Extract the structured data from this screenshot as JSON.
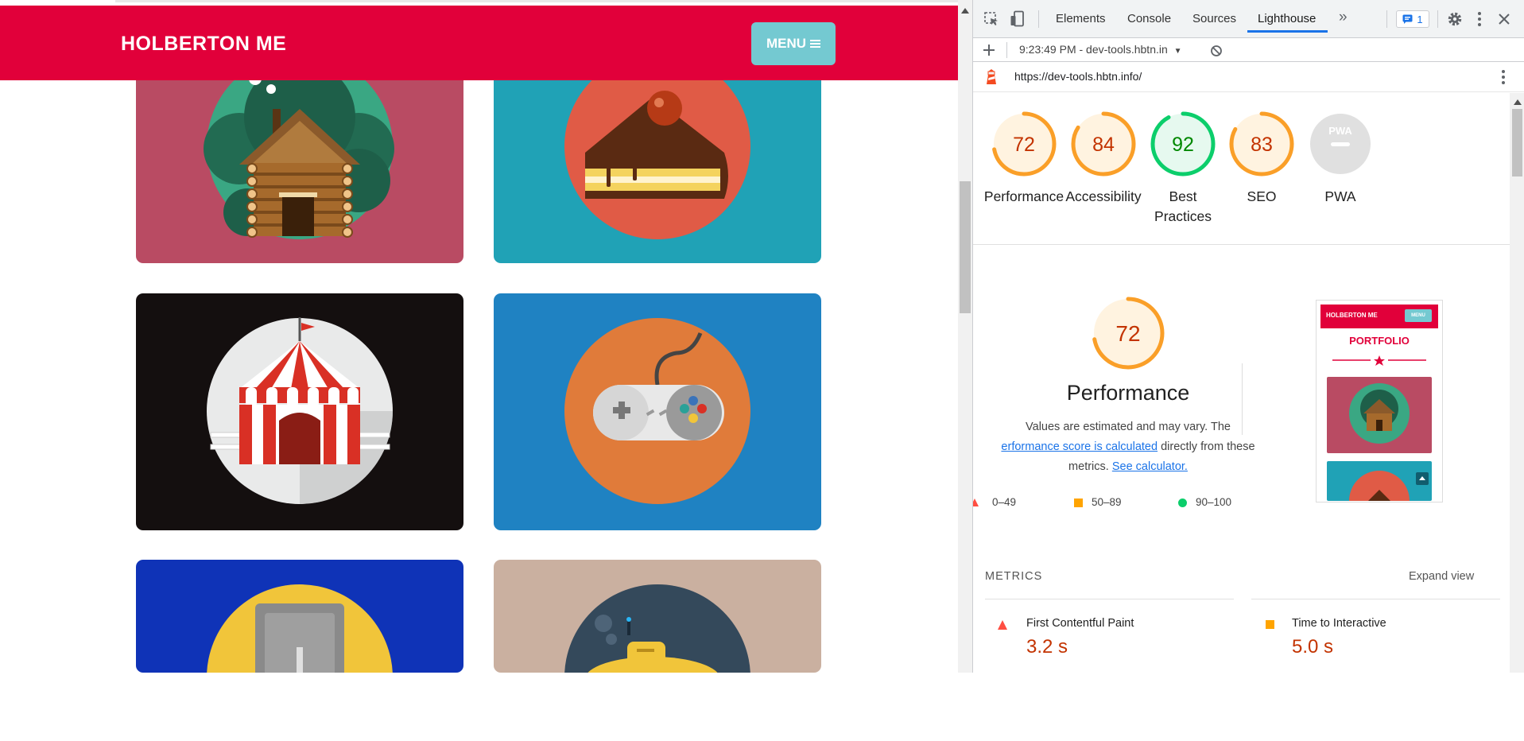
{
  "page": {
    "brand": "HOLBERTON ME",
    "menu_label": "MENU",
    "cards": [
      {
        "name": "cabin-illustration",
        "bg": "#b94b63",
        "circle": "#3aa783"
      },
      {
        "name": "cake-illustration",
        "bg": "#20a2b6",
        "circle": "#e05b46"
      },
      {
        "name": "circus-tent-illustration",
        "bg": "#140f0f",
        "circle": "#e9eaea"
      },
      {
        "name": "game-controller-illustration",
        "bg": "#1f82c2",
        "circle": "#e07b3a"
      },
      {
        "name": "safe-illustration",
        "bg": "#0f33b7",
        "circle": "#f1c53a"
      },
      {
        "name": "submarine-illustration",
        "bg": "#cab0a0",
        "circle": "#34495b"
      }
    ]
  },
  "devtools": {
    "tabs": [
      "Elements",
      "Console",
      "Sources",
      "Lighthouse"
    ],
    "active_tab": "Lighthouse",
    "issues_count": "1",
    "report_select": "9:23:49 PM - dev-tools.hbtn.in",
    "url": "https://dev-tools.hbtn.info/",
    "scores": [
      {
        "label": "Performance",
        "value": "72",
        "color": "#fa9f28",
        "fill": "#fff3e0",
        "text": "#c33300",
        "fraction": 0.72
      },
      {
        "label": "Accessibility",
        "value": "84",
        "color": "#fa9f28",
        "fill": "#fff3e0",
        "text": "#c33300",
        "fraction": 0.84
      },
      {
        "label": "Best Practices",
        "value": "92",
        "color": "#0cce6b",
        "fill": "#e6f9ef",
        "text": "#008800",
        "fraction": 0.92
      },
      {
        "label": "SEO",
        "value": "83",
        "color": "#fa9f28",
        "fill": "#fff3e0",
        "text": "#c33300",
        "fraction": 0.83
      },
      {
        "label": "PWA",
        "value": "PWA",
        "color": "#d8d8d8",
        "fill": "#e0e0e0",
        "text": "#ffffff",
        "fraction": 0
      }
    ],
    "perf": {
      "score": "72",
      "title": "Performance",
      "desc_1": "Values are estimated and may vary. The",
      "desc_link": "erformance score is calculated",
      "desc_2": " directly from these",
      "desc_3": "metrics.",
      "calc_link": "See calculator."
    },
    "legend": [
      {
        "range": "0–49",
        "color": "#ff4e42"
      },
      {
        "range": "50–89",
        "color": "#ffa400"
      },
      {
        "range": "90–100",
        "color": "#0cce6b"
      }
    ],
    "thumb": {
      "brand": "HOLBERTON ME",
      "menu": "MENU",
      "heading": "PORTFOLIO"
    },
    "metrics_heading": "METRICS",
    "expand_view": "Expand view",
    "metrics": [
      {
        "name": "First Contentful Paint",
        "value": "3.2 s",
        "status": "fail"
      },
      {
        "name": "Time to Interactive",
        "value": "5.0 s",
        "status": "average"
      }
    ]
  }
}
